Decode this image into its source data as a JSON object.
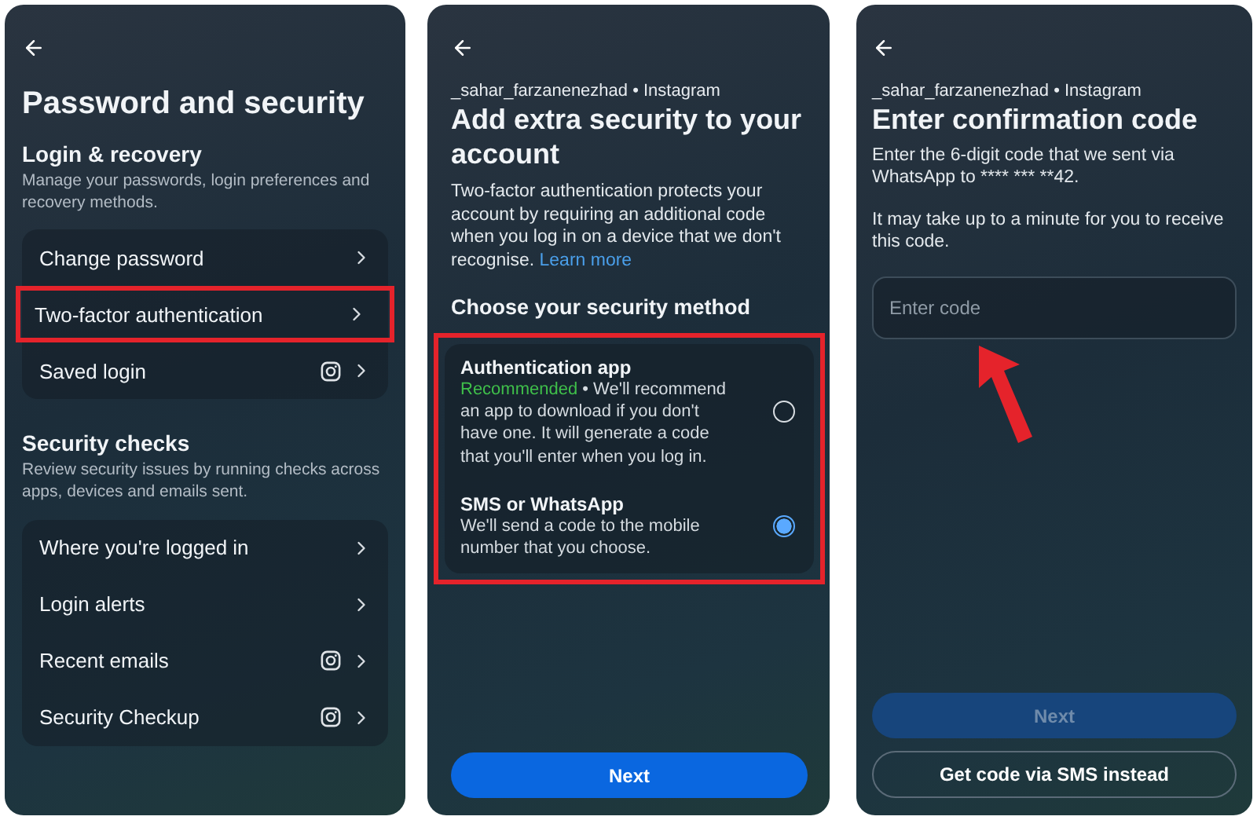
{
  "screens": [
    {
      "kind": "settings",
      "title": "Password and security",
      "sections": [
        {
          "heading": "Login & recovery",
          "description": "Manage your passwords, login preferences and recovery methods.",
          "items": [
            {
              "label": "Change password",
              "app_icon": false,
              "highlighted": false
            },
            {
              "label": "Two-factor authentication",
              "app_icon": false,
              "highlighted": true
            },
            {
              "label": "Saved login",
              "app_icon": true,
              "highlighted": false
            }
          ]
        },
        {
          "heading": "Security checks",
          "description": "Review security issues by running checks across apps, devices and emails sent.",
          "items": [
            {
              "label": "Where you're logged in",
              "app_icon": false,
              "highlighted": false
            },
            {
              "label": "Login alerts",
              "app_icon": false,
              "highlighted": false
            },
            {
              "label": "Recent emails",
              "app_icon": true,
              "highlighted": false
            },
            {
              "label": "Security Checkup",
              "app_icon": true,
              "highlighted": false
            }
          ]
        }
      ]
    },
    {
      "kind": "method",
      "account": "_sahar_farzanenezhad • Instagram",
      "title": "Add extra security to your account",
      "description": "Two-factor authentication protects your account by requiring an additional code when you log in on a device that we don't recognise.",
      "link": "Learn more",
      "subheading": "Choose your security method",
      "method_group": {
        "highlighted": true,
        "options": [
          {
            "title": "Authentication app",
            "tag": "Recommended",
            "description": " • We'll recommend an app to download if you don't have one. It will generate a code that you'll enter when you log in.",
            "selected": false
          },
          {
            "title": "SMS or WhatsApp",
            "description": "We'll send a code to the mobile number that you choose.",
            "selected": true
          }
        ]
      },
      "buttons": [
        {
          "label": "Next",
          "kind": "primary",
          "disabled": false
        }
      ]
    },
    {
      "kind": "code",
      "account": "_sahar_farzanenezhad • Instagram",
      "title": "Enter confirmation code",
      "paragraphs": [
        "Enter the 6-digit code that we sent via WhatsApp to **** *** **42.",
        "It may take up to a minute for you to receive this code."
      ],
      "field": {
        "placeholder": "Enter code",
        "pointed": true
      },
      "buttons": [
        {
          "label": "Next",
          "kind": "primary",
          "disabled": true
        },
        {
          "label": "Get code via SMS instead",
          "kind": "outline",
          "disabled": false
        }
      ]
    }
  ]
}
